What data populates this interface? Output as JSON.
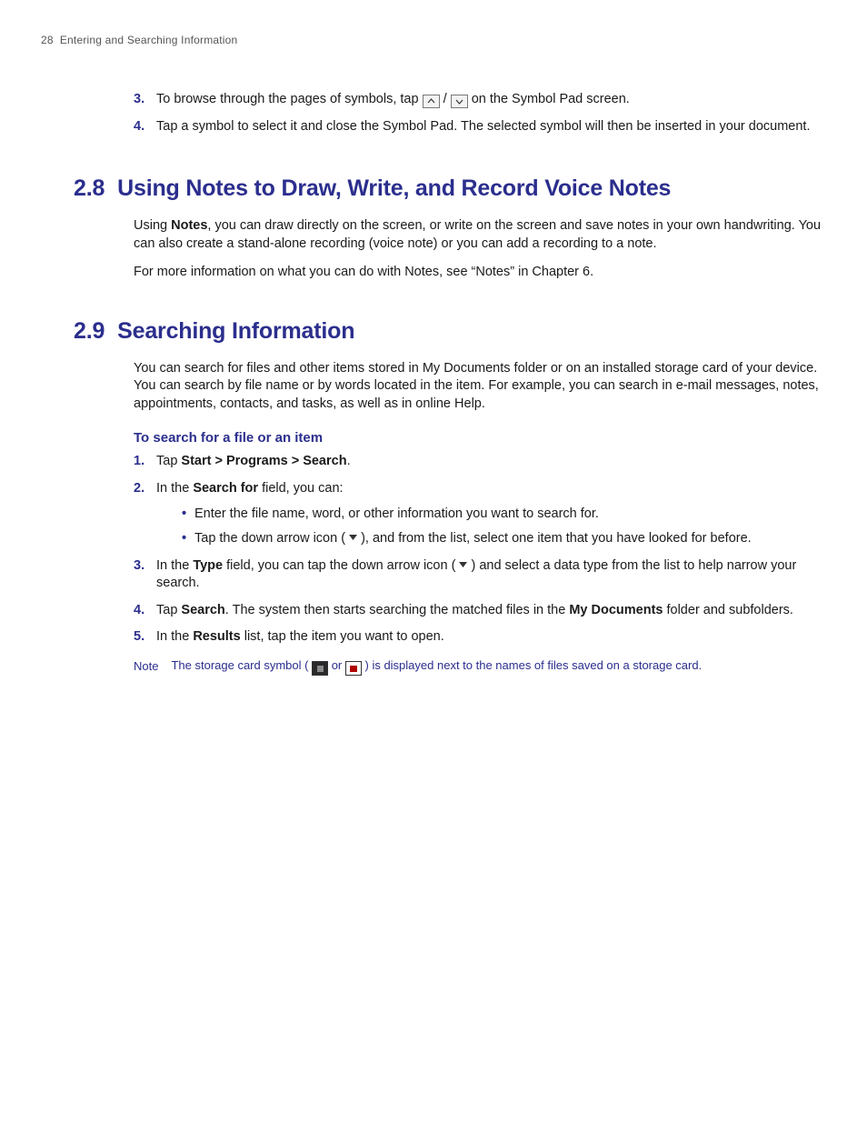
{
  "header": {
    "page_number": "28",
    "chapter": "Entering and Searching Information"
  },
  "top_list": {
    "item3_before": "To browse through the pages of symbols, tap ",
    "item3_sep": " / ",
    "item3_after": " on the Symbol Pad screen.",
    "item4": "Tap a symbol to select it and close the Symbol Pad. The selected symbol will then be inserted in your document."
  },
  "section28": {
    "num": "2.8",
    "title": "Using Notes to Draw, Write, and Record Voice Notes",
    "p1_a": "Using ",
    "p1_bold": "Notes",
    "p1_b": ", you can draw directly on the screen, or write on the screen and save notes in your own handwriting. You can also create a stand-alone recording (voice note) or you can add a recording to a note.",
    "p2": "For more information on what you can do with Notes, see “Notes” in Chapter 6."
  },
  "section29": {
    "num": "2.9",
    "title": "Searching Information",
    "intro": "You can search for files and other items stored in My Documents folder or on an installed storage card of your device. You can search by file name or by words located in the item. For example, you can search in e-mail messages, notes, appointments, contacts, and tasks, as well as in online Help.",
    "sub": "To search for a file or an item",
    "step1_a": "Tap ",
    "step1_bold": "Start > Programs > Search",
    "step1_b": ".",
    "step2_a": "In the ",
    "step2_bold": "Search for",
    "step2_b": " field, you can:",
    "step2_bul1": "Enter the file name, word, or other information you want to search for.",
    "step2_bul2_a": "Tap the down arrow icon ( ",
    "step2_bul2_b": " ), and from the list, select one item that you have looked for before.",
    "step3_a": "In the ",
    "step3_bold": "Type",
    "step3_b": " field, you can tap the down arrow icon ( ",
    "step3_c": " ) and select a data type from the list to help narrow your search.",
    "step4_a": "Tap ",
    "step4_bold1": "Search",
    "step4_b": ". The system then starts searching the matched files in the ",
    "step4_bold2": "My Documents",
    "step4_c": " folder and subfolders.",
    "step5_a": "In the ",
    "step5_bold": "Results",
    "step5_b": " list, tap the item you want to open.",
    "note_label": "Note",
    "note_a": "The storage card symbol ( ",
    "note_or": " or ",
    "note_b": " ) is displayed next to the names of files saved on a storage card."
  },
  "markers": {
    "m3": "3.",
    "m4": "4.",
    "m1": "1.",
    "m2": "2.",
    "m5": "5."
  }
}
